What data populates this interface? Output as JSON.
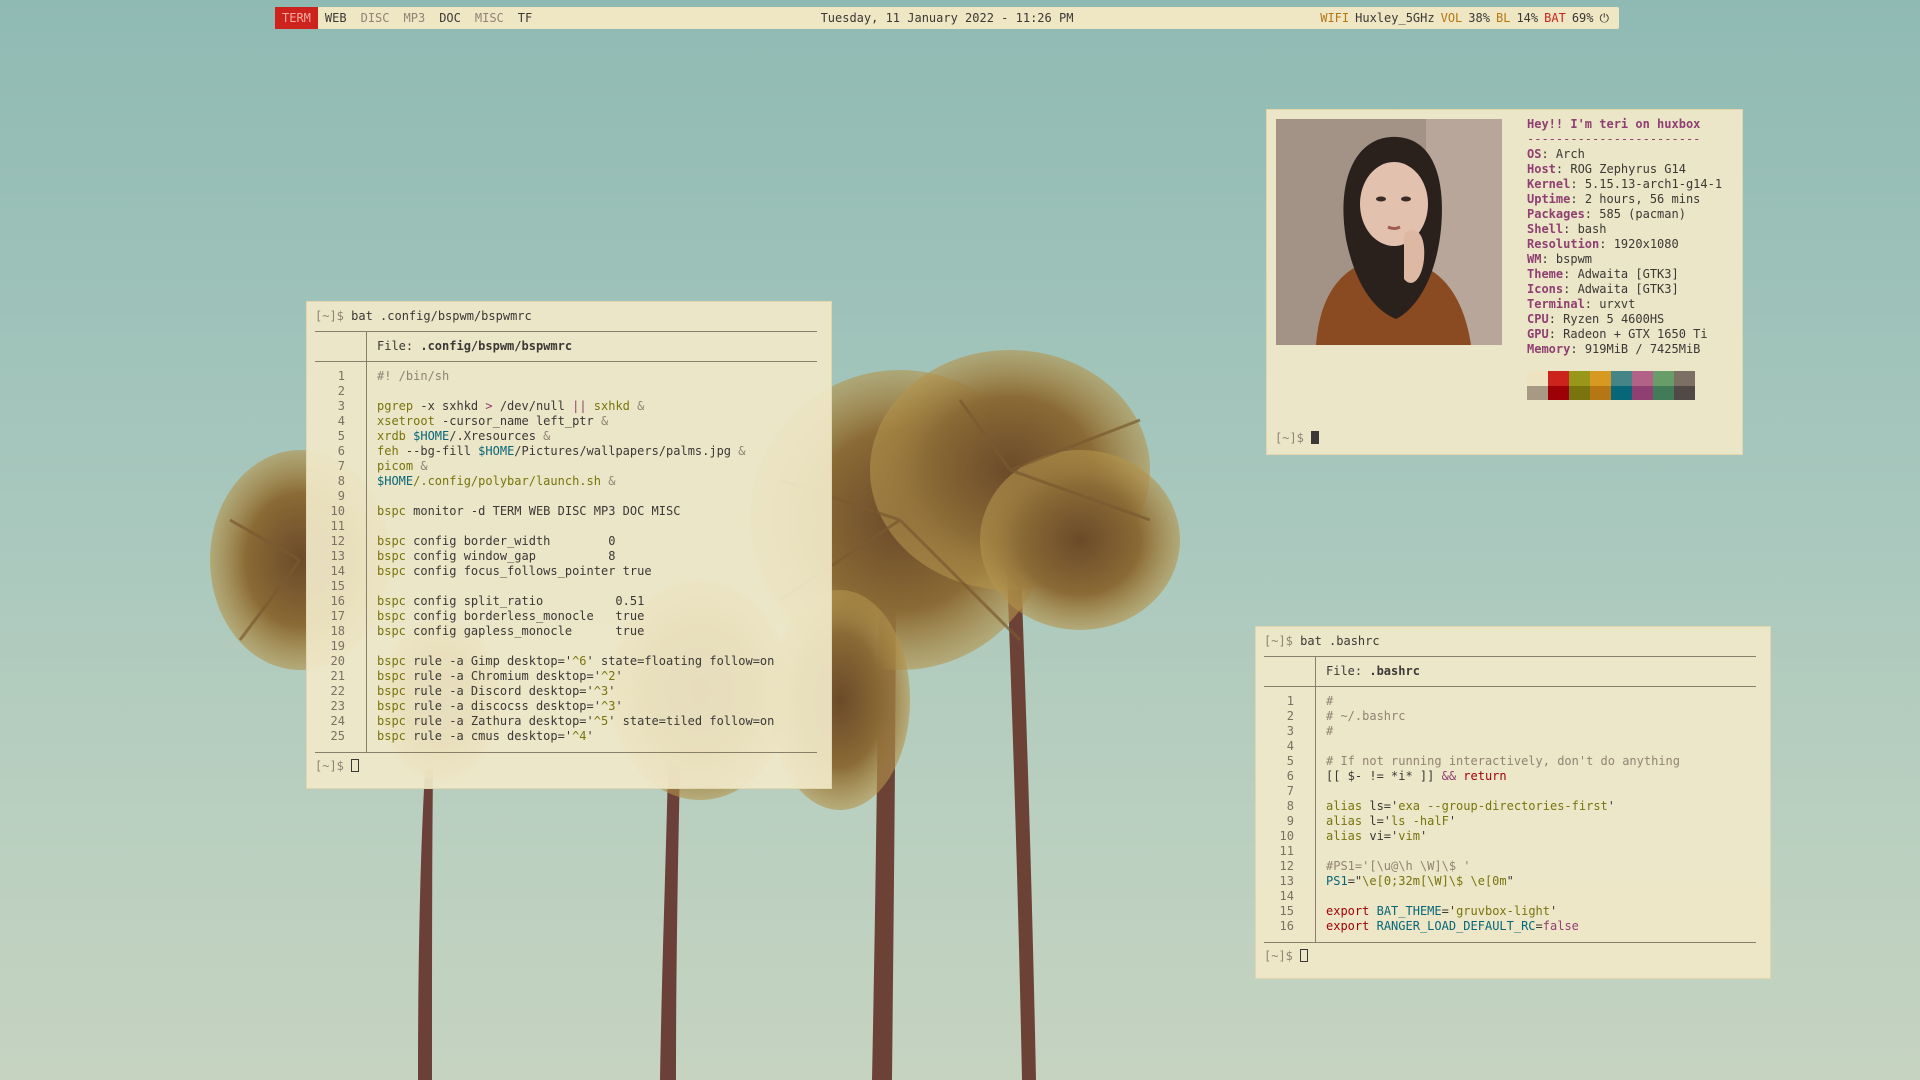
{
  "bar": {
    "workspaces": [
      {
        "label": "TERM",
        "state": "active"
      },
      {
        "label": "WEB",
        "state": "occupied"
      },
      {
        "label": "DISC",
        "state": "empty"
      },
      {
        "label": "MP3",
        "state": "empty"
      },
      {
        "label": "DOC",
        "state": "occupied"
      },
      {
        "label": "MISC",
        "state": "empty"
      },
      {
        "label": "TF",
        "state": "occupied"
      }
    ],
    "clock": "Tuesday, 11 January 2022 - 11:26 PM",
    "wifi_label": "WIFI",
    "wifi_value": "Huxley_5GHz",
    "vol_label": "VOL",
    "vol_value": "38%",
    "bl_label": "BL",
    "bl_value": "14%",
    "bat_label": "BAT",
    "bat_value": "69%",
    "power_icon": "power-icon"
  },
  "colors": {
    "active_workspace": "#cc241d",
    "bar_bg": "#efe6c4",
    "terminal_bg": "#f0e8c8"
  },
  "bspwm_window": {
    "prompt": "[~]$ ",
    "command": "bat .config/bspwm/bspwmrc",
    "file_label": "File: ",
    "file_name": ".config/bspwm/bspwmrc",
    "bottom_prompt": "[~]$ ",
    "lines": [
      {
        "n": "1",
        "segs": [
          [
            "#! /bin/sh",
            "c-cmt"
          ]
        ]
      },
      {
        "n": "2",
        "segs": []
      },
      {
        "n": "3",
        "segs": [
          [
            "pgrep",
            "c-str"
          ],
          [
            " -x sxhkd ",
            ""
          ],
          [
            ">",
            "c-op"
          ],
          [
            " /dev/null ",
            ""
          ],
          [
            "||",
            "c-op"
          ],
          [
            " sxhkd ",
            "c-str"
          ],
          [
            "&",
            "c-amp"
          ]
        ]
      },
      {
        "n": "4",
        "segs": [
          [
            "xsetroot",
            "c-str"
          ],
          [
            " -cursor_name left_ptr ",
            ""
          ],
          [
            "&",
            "c-amp"
          ]
        ]
      },
      {
        "n": "5",
        "segs": [
          [
            "xrdb ",
            "c-str"
          ],
          [
            "$HOME",
            "c-var"
          ],
          [
            "/.Xresources ",
            ""
          ],
          [
            "&",
            "c-amp"
          ]
        ]
      },
      {
        "n": "6",
        "segs": [
          [
            "feh",
            "c-str"
          ],
          [
            " --bg-fill ",
            ""
          ],
          [
            "$HOME",
            "c-var"
          ],
          [
            "/Pictures/wallpapers/palms.jpg ",
            ""
          ],
          [
            "&",
            "c-amp"
          ]
        ]
      },
      {
        "n": "7",
        "segs": [
          [
            "picom ",
            "c-str"
          ],
          [
            "&",
            "c-amp"
          ]
        ]
      },
      {
        "n": "8",
        "segs": [
          [
            "$HOME",
            "c-var"
          ],
          [
            "/.config/polybar/launch.sh ",
            "c-str"
          ],
          [
            "&",
            "c-amp"
          ]
        ]
      },
      {
        "n": "9",
        "segs": []
      },
      {
        "n": "10",
        "segs": [
          [
            "bspc",
            "c-str"
          ],
          [
            " monitor -d TERM WEB DISC MP3 DOC MISC",
            ""
          ]
        ]
      },
      {
        "n": "11",
        "segs": []
      },
      {
        "n": "12",
        "segs": [
          [
            "bspc",
            "c-str"
          ],
          [
            " config border_width        0",
            ""
          ]
        ]
      },
      {
        "n": "13",
        "segs": [
          [
            "bspc",
            "c-str"
          ],
          [
            " config window_gap          8",
            ""
          ]
        ]
      },
      {
        "n": "14",
        "segs": [
          [
            "bspc",
            "c-str"
          ],
          [
            " config focus_follows_pointer true",
            ""
          ]
        ]
      },
      {
        "n": "15",
        "segs": []
      },
      {
        "n": "16",
        "segs": [
          [
            "bspc",
            "c-str"
          ],
          [
            " config split_ratio          0.51",
            ""
          ]
        ]
      },
      {
        "n": "17",
        "segs": [
          [
            "bspc",
            "c-str"
          ],
          [
            " config borderless_monocle   true",
            ""
          ]
        ]
      },
      {
        "n": "18",
        "segs": [
          [
            "bspc",
            "c-str"
          ],
          [
            " config gapless_monocle      true",
            ""
          ]
        ]
      },
      {
        "n": "19",
        "segs": []
      },
      {
        "n": "20",
        "segs": [
          [
            "bspc",
            "c-str"
          ],
          [
            " rule -a Gimp desktop='",
            ""
          ],
          [
            "^6",
            "c-str"
          ],
          [
            "' state=floating follow=on",
            ""
          ]
        ]
      },
      {
        "n": "21",
        "segs": [
          [
            "bspc",
            "c-str"
          ],
          [
            " rule -a Chromium desktop='",
            ""
          ],
          [
            "^2",
            "c-str"
          ],
          [
            "'",
            ""
          ]
        ]
      },
      {
        "n": "22",
        "segs": [
          [
            "bspc",
            "c-str"
          ],
          [
            " rule -a Discord desktop='",
            ""
          ],
          [
            "^3",
            "c-str"
          ],
          [
            "'",
            ""
          ]
        ]
      },
      {
        "n": "23",
        "segs": [
          [
            "bspc",
            "c-str"
          ],
          [
            " rule -a discocss desktop='",
            ""
          ],
          [
            "^3",
            "c-str"
          ],
          [
            "'",
            ""
          ]
        ]
      },
      {
        "n": "24",
        "segs": [
          [
            "bspc",
            "c-str"
          ],
          [
            " rule -a Zathura desktop='",
            ""
          ],
          [
            "^5",
            "c-str"
          ],
          [
            "' state=tiled follow=on",
            ""
          ]
        ]
      },
      {
        "n": "25",
        "segs": [
          [
            "bspc",
            "c-str"
          ],
          [
            " rule -a cmus desktop='",
            ""
          ],
          [
            "^4",
            "c-str"
          ],
          [
            "'",
            ""
          ]
        ]
      }
    ]
  },
  "neofetch_window": {
    "title": "Hey!! I'm teri on huxbox",
    "separator": "------------------------",
    "fields": [
      {
        "key": "OS",
        "value": "Arch"
      },
      {
        "key": "Host",
        "value": "ROG Zephyrus G14"
      },
      {
        "key": "Kernel",
        "value": "5.15.13-arch1-g14-1"
      },
      {
        "key": "Uptime",
        "value": "2 hours, 56 mins"
      },
      {
        "key": "Packages",
        "value": "585 (pacman)"
      },
      {
        "key": "Shell",
        "value": "bash"
      },
      {
        "key": "Resolution",
        "value": "1920x1080"
      },
      {
        "key": "WM",
        "value": "bspwm"
      },
      {
        "key": "Theme",
        "value": "Adwaita [GTK3]"
      },
      {
        "key": "Icons",
        "value": "Adwaita [GTK3]"
      },
      {
        "key": "Terminal",
        "value": "urxvt"
      },
      {
        "key": "CPU",
        "value": "Ryzen 5 4600HS"
      },
      {
        "key": "GPU",
        "value": "Radeon + GTX 1650 Ti"
      },
      {
        "key": "Memory",
        "value": "919MiB / 7425MiB"
      }
    ],
    "swatches": [
      [
        "#ede3c0",
        "#a89984"
      ],
      [
        "#cc241d",
        "#9d0006"
      ],
      [
        "#98971a",
        "#79740e"
      ],
      [
        "#d79921",
        "#b57614"
      ],
      [
        "#458588",
        "#076678"
      ],
      [
        "#b16286",
        "#8f3f71"
      ],
      [
        "#689d6a",
        "#427b58"
      ],
      [
        "#7c6f64",
        "#504945"
      ]
    ],
    "prompt": "[~]$ "
  },
  "bashrc_window": {
    "prompt": "[~]$ ",
    "command": "bat .bashrc",
    "file_label": "File: ",
    "file_name": ".bashrc",
    "bottom_prompt": "[~]$ ",
    "lines": [
      {
        "n": "1",
        "segs": [
          [
            "#",
            "c-cmt"
          ]
        ]
      },
      {
        "n": "2",
        "segs": [
          [
            "# ~/.bashrc",
            "c-cmt"
          ]
        ]
      },
      {
        "n": "3",
        "segs": [
          [
            "#",
            "c-cmt"
          ]
        ]
      },
      {
        "n": "4",
        "segs": []
      },
      {
        "n": "5",
        "segs": [
          [
            "# If not running interactively, don't do anything",
            "c-cmt"
          ]
        ]
      },
      {
        "n": "6",
        "segs": [
          [
            "[[ $- != *i* ]] ",
            ""
          ],
          [
            "&&",
            "c-op"
          ],
          [
            " ",
            ""
          ],
          [
            "return",
            "c-kw"
          ]
        ]
      },
      {
        "n": "7",
        "segs": []
      },
      {
        "n": "8",
        "segs": [
          [
            "alias",
            "c-str"
          ],
          [
            " ls='",
            ""
          ],
          [
            "exa --group-directories-first",
            "c-str"
          ],
          [
            "'",
            ""
          ]
        ]
      },
      {
        "n": "9",
        "segs": [
          [
            "alias",
            "c-str"
          ],
          [
            " l='",
            ""
          ],
          [
            "ls -halF",
            "c-str"
          ],
          [
            "'",
            ""
          ]
        ]
      },
      {
        "n": "10",
        "segs": [
          [
            "alias",
            "c-str"
          ],
          [
            " vi='",
            ""
          ],
          [
            "vim",
            "c-str"
          ],
          [
            "'",
            ""
          ]
        ]
      },
      {
        "n": "11",
        "segs": []
      },
      {
        "n": "12",
        "segs": [
          [
            "#PS1='[\\u@\\h \\W]\\$ '",
            "c-cmt"
          ]
        ]
      },
      {
        "n": "13",
        "segs": [
          [
            "PS1",
            "c-var"
          ],
          [
            "=\"",
            ""
          ],
          [
            "\\e[0;32m[\\W]\\$ \\e[0m",
            "c-str"
          ],
          [
            "\"",
            ""
          ]
        ]
      },
      {
        "n": "14",
        "segs": []
      },
      {
        "n": "15",
        "segs": [
          [
            "export",
            "c-kw"
          ],
          [
            " ",
            ""
          ],
          [
            "BAT_THEME",
            "c-var"
          ],
          [
            "='",
            ""
          ],
          [
            "gruvbox-light",
            "c-str"
          ],
          [
            "'",
            ""
          ]
        ]
      },
      {
        "n": "16",
        "segs": [
          [
            "export",
            "c-kw"
          ],
          [
            " ",
            ""
          ],
          [
            "RANGER_LOAD_DEFAULT_RC",
            "c-var"
          ],
          [
            "=",
            ""
          ],
          [
            "false",
            "c-op"
          ]
        ]
      }
    ]
  }
}
